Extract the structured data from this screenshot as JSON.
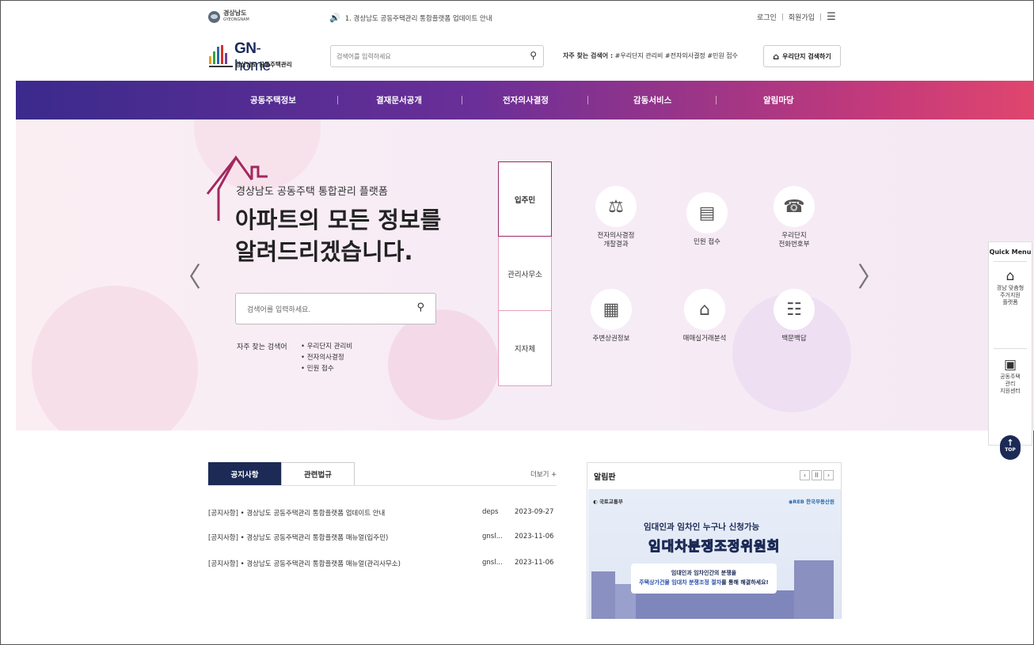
{
  "topbar": {
    "province_name": "경상남도",
    "province_sub": "GYEONGNAM",
    "notice": "1. 경상남도 공동주택관리 통합플랫폼 업데이트 안내",
    "login": "로그인",
    "signup": "회원가입",
    "divider": "|"
  },
  "header": {
    "logo_title_bold": "GN",
    "logo_title_rest": "-home",
    "logo_subtitle": "경상남도 공동주택관리",
    "search_placeholder": "검색어를 입력하세요",
    "frequent_label": "자주 찾는 검색어 :",
    "frequent_terms": "#우리단지 관리비  #전자의사결정  #민원 접수",
    "apt_search_button": "우리단지 검색하기"
  },
  "nav": {
    "items": [
      "공동주택정보",
      "결재문서공개",
      "전자의사결정",
      "감동서비스",
      "알림마당"
    ]
  },
  "hero": {
    "subtitle": "경상남도 공동주택 통합관리 플랫폼",
    "title_line1": "아파트의 모든 정보를",
    "title_line2": "알려드리겠습니다.",
    "search_placeholder": "검색어를 입력하세요.",
    "frequent_label": "자주 찾는 검색어",
    "frequent_items": [
      "우리단지 관리비",
      "전자의사결정",
      "민원 접수"
    ],
    "prev_arrow": "〈",
    "next_arrow": "〉",
    "tabs": [
      "입주민",
      "관리사무소",
      "지자체"
    ],
    "services": [
      {
        "label1": "전자의사결정",
        "label2": "개찰결과",
        "icon": "vote-icon"
      },
      {
        "label1": "민원 접수",
        "label2": "",
        "icon": "complaint-icon"
      },
      {
        "label1": "우리단지",
        "label2": "전화번호부",
        "icon": "phonebook-icon"
      },
      {
        "label1": "주변상권정보",
        "label2": "",
        "icon": "commerce-icon"
      },
      {
        "label1": "매매실거래분석",
        "label2": "",
        "icon": "house-trade-icon"
      },
      {
        "label1": "백문백답",
        "label2": "",
        "icon": "qa-icon"
      }
    ]
  },
  "quick_menu": {
    "title": "Quick Menu",
    "item1": [
      "경남 맞춤형",
      "주거지원",
      "플랫폼"
    ],
    "item2": [
      "공동주택",
      "관리",
      "지원센터"
    ],
    "top": "TOP"
  },
  "notices": {
    "tab_active": "공지사항",
    "tab_inactive": "관련법규",
    "more": "더보기 +",
    "rows": [
      {
        "title": "[공지사항]  •  경상남도 공동주택관리 통합플랫폼 업데이트 안내",
        "author": "deps",
        "date": "2023-09-27"
      },
      {
        "title": "[공지사항]  •  경상남도 공동주택관리 통합플랫폼 매뉴얼(입주민)",
        "author": "gnsl...",
        "date": "2023-11-06"
      },
      {
        "title": "[공지사항]  •  경상남도 공동주택관리 통합플랫폼 매뉴얼(관리사무소)",
        "author": "gnsl...",
        "date": "2023-11-06"
      }
    ]
  },
  "board": {
    "title": "알림판",
    "ctrl_prev": "‹",
    "ctrl_pause": "II",
    "ctrl_next": "›",
    "banner_left": "국토교통부",
    "banner_right": "한국부동산원",
    "banner_line1": "임대인과 임차인 누구나 신청가능",
    "banner_line2": "임대차분쟁조정위원회",
    "banner_box1": "임대인과 임차인간의 분쟁을",
    "banner_box2a": "주택상가건물 임대차 분쟁조정 절차",
    "banner_box2b": "를 통해 해결하세요!"
  },
  "colors": {
    "nav_start": "#3b2a8c",
    "nav_end": "#e0466e",
    "navy": "#1c2a55",
    "tab_border": "#e8a0bc"
  }
}
